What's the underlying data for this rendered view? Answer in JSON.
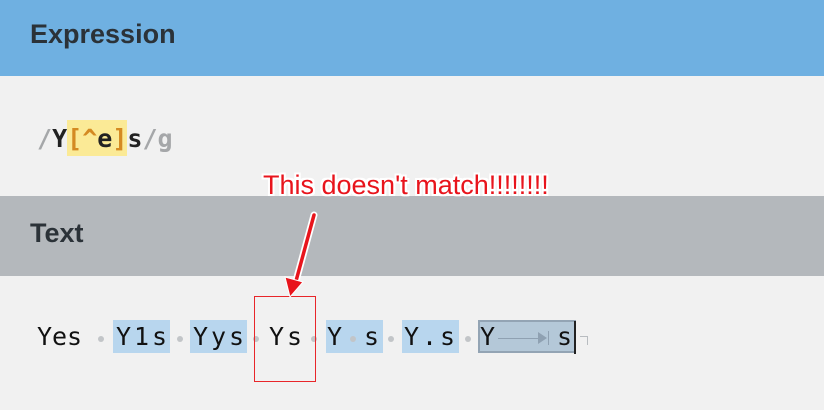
{
  "expression": {
    "title": "Expression",
    "open_delim": "/",
    "literal_1": "Y",
    "set_open": "[",
    "set_negation": "^",
    "set_content": "e",
    "set_close": "]",
    "literal_2": "s",
    "close_delim": "/",
    "flags": "g"
  },
  "text": {
    "title": "Text",
    "chars": [
      "Y",
      "e",
      "s",
      "Y",
      "1",
      "s",
      "Y",
      "y",
      "s",
      "Y",
      "s",
      "Y",
      "s",
      "Y",
      ".",
      "s",
      "Y",
      "s"
    ]
  },
  "annotation": {
    "label": "This doesn't match!!!!!!!!",
    "color": "#e8141c"
  },
  "colors": {
    "expression_header": "#6fb0e1",
    "text_header": "#b4b8bc",
    "match_highlight": "#b8d6ee",
    "set_highlight": "#fbea96"
  }
}
